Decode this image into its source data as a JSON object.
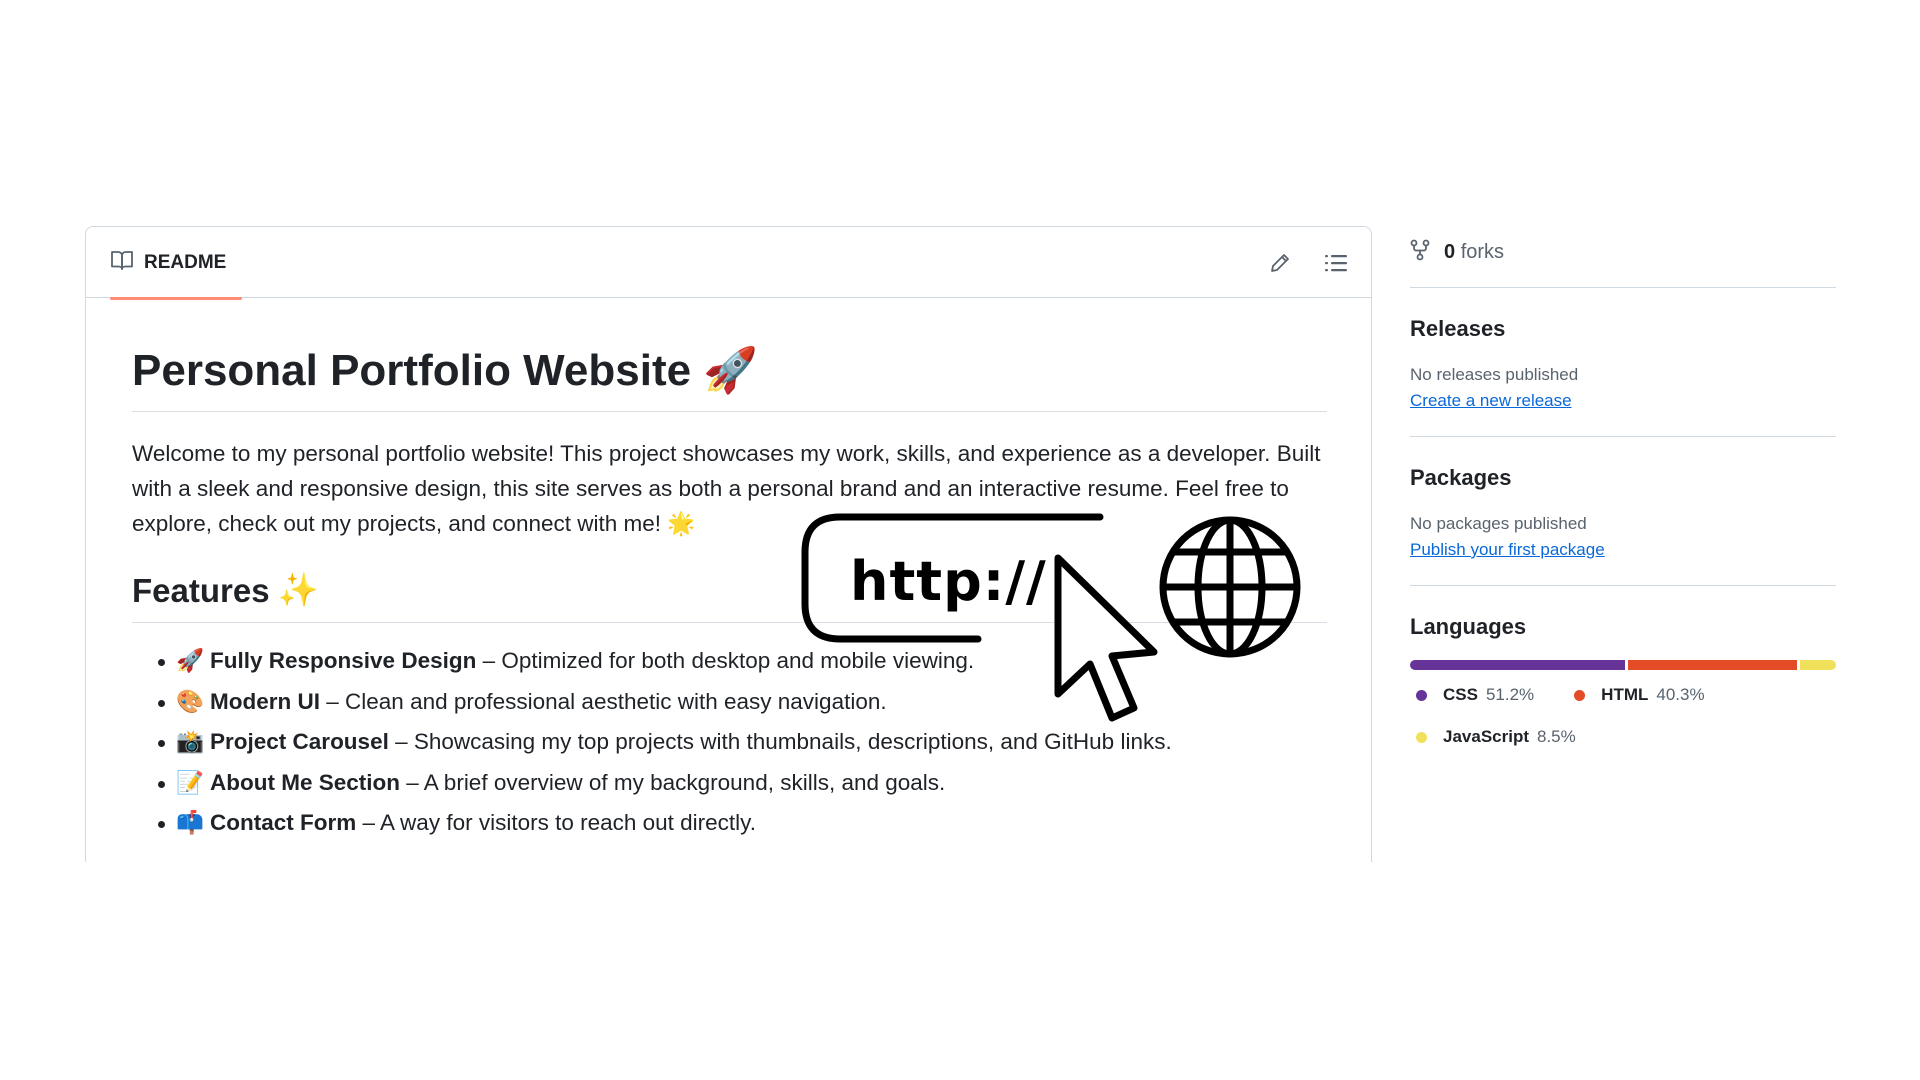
{
  "readme": {
    "tab_label": "README",
    "title": "Personal Portfolio Website",
    "title_emoji": "🚀",
    "intro": "Welcome to my personal portfolio website! This project showcases my work, skills, and experience as a developer. Built with a sleek and responsive design, this site serves as both a personal brand and an interactive resume. Feel free to explore, check out my projects, and connect with me! 🌟",
    "features_heading": "Features",
    "features_emoji": "✨",
    "features": [
      {
        "emoji": "🚀",
        "bold": "Fully Responsive Design",
        "text": " – Optimized for both desktop and mobile viewing."
      },
      {
        "emoji": "🎨",
        "bold": "Modern UI",
        "text": " – Clean and professional aesthetic with easy navigation."
      },
      {
        "emoji": "📸",
        "bold": "Project Carousel",
        "text": " – Showcasing my top projects with thumbnails, descriptions, and GitHub links."
      },
      {
        "emoji": "📝",
        "bold": "About Me Section",
        "text": " – A brief overview of my background, skills, and goals."
      },
      {
        "emoji": "📫",
        "bold": "Contact Form",
        "text": " – A way for visitors to reach out directly."
      }
    ]
  },
  "overlay": {
    "url_text": "http://"
  },
  "sidebar": {
    "forks_count": "0",
    "forks_label": "forks",
    "releases": {
      "heading": "Releases",
      "empty": "No releases published",
      "link": "Create a new release"
    },
    "packages": {
      "heading": "Packages",
      "empty": "No packages published",
      "link": "Publish your first package"
    },
    "languages": {
      "heading": "Languages",
      "items": [
        {
          "name": "CSS",
          "percent": "51.2%",
          "share": 51.2,
          "color": "#663399"
        },
        {
          "name": "HTML",
          "percent": "40.3%",
          "share": 40.3,
          "color": "#e34c26"
        },
        {
          "name": "JavaScript",
          "percent": "8.5%",
          "share": 8.5,
          "color": "#f1e05a"
        }
      ]
    }
  },
  "icons": [
    "book-icon",
    "pencil-icon",
    "list-icon",
    "fork-icon",
    "cursor-icon",
    "globe-icon"
  ]
}
